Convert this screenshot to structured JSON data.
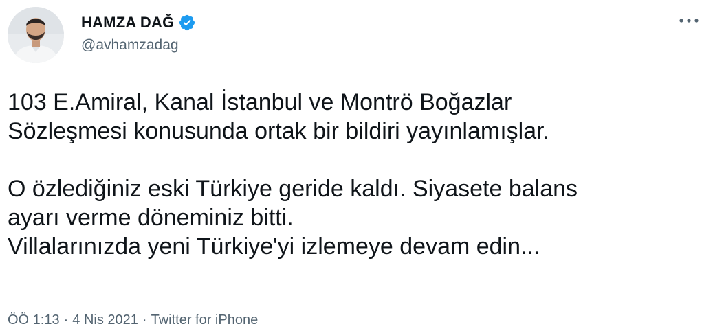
{
  "user": {
    "display_name": "HAMZA DAĞ",
    "handle": "@avhamzadag",
    "verified": true
  },
  "tweet": {
    "lines": [
      "103 E.Amiral, Kanal İstanbul ve Montrö Boğazlar",
      "Sözleşmesi konusunda ortak bir bildiri yayınlamışlar.",
      "",
      "O özlediğiniz eski Türkiye geride kaldı. Siyasete balans",
      "ayarı verme döneminiz bitti.",
      "Villalarınızda yeni Türkiye'yi izlemeye devam edin..."
    ]
  },
  "meta": {
    "time": "ÖÖ 1:13",
    "separator": "·",
    "date": "4 Nis 2021",
    "source": "Twitter for iPhone"
  },
  "icons": {
    "verified": "verified-badge-icon",
    "more": "more-options-icon"
  },
  "colors": {
    "text": "#0f1419",
    "secondary": "#536471",
    "verified_blue": "#1d9bf0"
  }
}
